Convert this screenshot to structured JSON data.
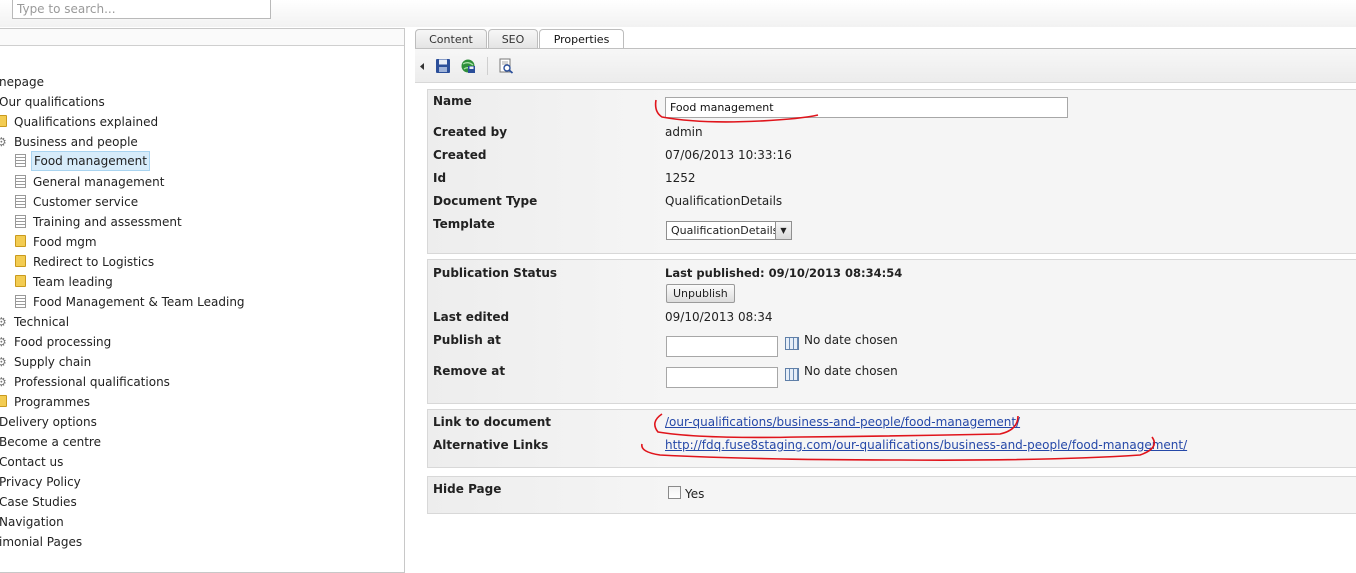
{
  "search": {
    "placeholder": "Type to search..."
  },
  "tree": {
    "items": [
      {
        "label": "nepage",
        "icon": "none",
        "selected": false
      },
      {
        "label": "Our qualifications",
        "icon": "none",
        "selected": false
      },
      {
        "label": "Qualifications explained",
        "icon": "folder-icon",
        "selected": false
      },
      {
        "label": "Business and people",
        "icon": "gears-icon",
        "selected": false
      },
      {
        "label": "Food management",
        "icon": "document-icon",
        "selected": true
      },
      {
        "label": "General management",
        "icon": "document-icon",
        "selected": false
      },
      {
        "label": "Customer service",
        "icon": "document-icon",
        "selected": false
      },
      {
        "label": "Training and assessment",
        "icon": "document-icon",
        "selected": false
      },
      {
        "label": "Food mgm",
        "icon": "folder-icon",
        "selected": false
      },
      {
        "label": "Redirect to Logistics",
        "icon": "folder-icon",
        "selected": false
      },
      {
        "label": "Team leading",
        "icon": "folder-icon",
        "selected": false
      },
      {
        "label": "Food Management & Team Leading",
        "icon": "document-icon",
        "selected": false
      },
      {
        "label": "Technical",
        "icon": "gears-icon",
        "selected": false
      },
      {
        "label": "Food processing",
        "icon": "gears-icon",
        "selected": false
      },
      {
        "label": "Supply chain",
        "icon": "gears-icon",
        "selected": false
      },
      {
        "label": "Professional qualifications",
        "icon": "gears-icon",
        "selected": false
      },
      {
        "label": "Programmes",
        "icon": "folder-icon",
        "selected": false
      },
      {
        "label": "Delivery options",
        "icon": "none",
        "selected": false
      },
      {
        "label": "Become a centre",
        "icon": "none",
        "selected": false
      },
      {
        "label": "Contact us",
        "icon": "none",
        "selected": false
      },
      {
        "label": "Privacy Policy",
        "icon": "none",
        "selected": false
      },
      {
        "label": "Case Studies",
        "icon": "none",
        "selected": false
      },
      {
        "label": "Navigation",
        "icon": "none",
        "selected": false
      },
      {
        "label": "imonial Pages",
        "icon": "none",
        "selected": false
      }
    ]
  },
  "tabs": [
    {
      "label": "Content",
      "active": false
    },
    {
      "label": "SEO",
      "active": false
    },
    {
      "label": "Properties",
      "active": true
    }
  ],
  "toolbar": {
    "buttons": [
      "save-icon",
      "save-and-publish-icon",
      "preview-icon"
    ]
  },
  "properties": {
    "name_label": "Name",
    "name_value": "Food management",
    "created_by_label": "Created by",
    "created_by_value": "admin",
    "created_label": "Created",
    "created_value": "07/06/2013 10:33:16",
    "id_label": "Id",
    "id_value": "1252",
    "doctype_label": "Document Type",
    "doctype_value": "QualificationDetails",
    "template_label": "Template",
    "template_value": "QualificationDetails"
  },
  "publication": {
    "status_label": "Publication Status",
    "last_published": "Last published: 09/10/2013 08:34:54",
    "unpublish_label": "Unpublish",
    "last_edited_label": "Last edited",
    "last_edited_value": "09/10/2013 08:34",
    "publish_at_label": "Publish at",
    "publish_at_value": "",
    "publish_at_note": "No date chosen",
    "remove_at_label": "Remove at",
    "remove_at_value": "",
    "remove_at_note": "No date chosen"
  },
  "links": {
    "link_label": "Link to document",
    "link_value": "/our-qualifications/business-and-people/food-management/",
    "alt_label": "Alternative Links",
    "alt_value": "http://fdq.fuse8staging.com/our-qualifications/business-and-people/food-management/"
  },
  "hide": {
    "label": "Hide Page",
    "checkbox_label": "Yes",
    "checked": false
  },
  "colors": {
    "annotation": "#e0141b",
    "link": "#2548a8",
    "selection": "#d7ecfa"
  }
}
